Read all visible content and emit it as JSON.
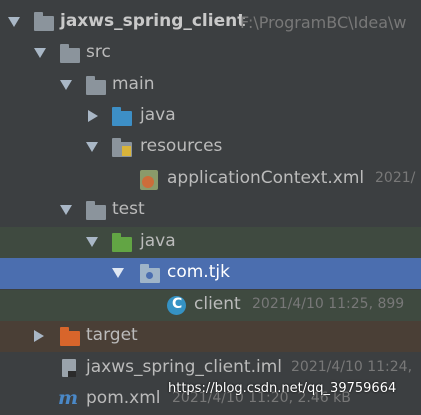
{
  "project": {
    "name": "jaxws_spring_client",
    "path": "F:\\ProgramBC\\Idea\\w"
  },
  "tree": {
    "src": "src",
    "main": "main",
    "java_main": "java",
    "resources": "resources",
    "app_context_file": "applicationContext.xml",
    "app_context_meta": "2021/",
    "test": "test",
    "java_test": "java",
    "package": "com.tjk",
    "client": "client",
    "client_meta": "2021/4/10 11:25, 899",
    "target": "target",
    "iml_file": "jaxws_spring_client.iml",
    "iml_meta": "2021/4/10 11:24,",
    "pom_file": "pom.xml",
    "pom_meta": "2021/4/10 11:20, 2.46 kB"
  },
  "watermark": "https://blog.csdn.net/qq_39759664",
  "colors": {
    "background": "#3c3f41",
    "selection": "#4b6eaf",
    "test_area": "#3f4a40",
    "excluded_area": "#4a3f36"
  }
}
